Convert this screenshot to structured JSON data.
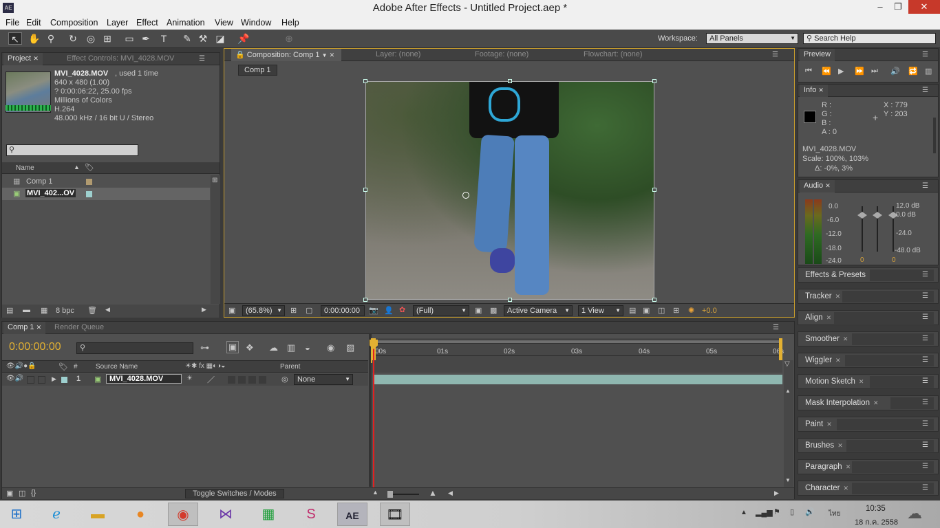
{
  "window": {
    "title": "Adobe After Effects - Untitled Project.aep *",
    "logo": "AE",
    "minimize": "–",
    "maximize": "❐",
    "close": "✕"
  },
  "menu": [
    "File",
    "Edit",
    "Composition",
    "Layer",
    "Effect",
    "Animation",
    "View",
    "Window",
    "Help"
  ],
  "toolbar": {
    "workspace_label": "Workspace:",
    "workspace_value": "All Panels",
    "search_placeholder": "Search Help"
  },
  "project": {
    "tab": "Project",
    "tab2": "Effect Controls: MVI_4028.MOV",
    "file_name": "MVI_4028.MOV",
    "used": ", used 1 time",
    "info": [
      "640 x 480 (1.00)",
      "? 0:00:06:22, 25.00 fps",
      "Millions of Colors",
      "H.264",
      "48.000 kHz / 16 bit U / Stereo"
    ],
    "col_name": "Name",
    "items": [
      {
        "name": "Comp 1",
        "color": "#b09a70"
      },
      {
        "name": "MVI_402...OV",
        "color": "#9ed0cf"
      }
    ],
    "bpc": "8 bpc"
  },
  "composition": {
    "tab": "Composition: Comp 1",
    "tab_layer": "Layer: (none)",
    "tab_footage": "Footage: (none)",
    "tab_flow": "Flowchart: (none)",
    "crumb": "Comp 1",
    "zoom": "(65.8%)",
    "timecode": "0:00:00:00",
    "resolution": "(Full)",
    "camera": "Active Camera",
    "views": "1 View",
    "exposure": "+0.0"
  },
  "preview": {
    "tab": "Preview"
  },
  "info": {
    "tab": "Info",
    "r": "R :",
    "g": "G :",
    "b": "B :",
    "a": "A : 0",
    "x": "X : 779",
    "y": "Y : 203",
    "line1": "MVI_4028.MOV",
    "line2": "Scale: 100%, 103%",
    "line3": "Δ: -0%, 3%"
  },
  "audio": {
    "tab": "Audio",
    "left_scale": [
      "0.0",
      "-6.0",
      "-12.0",
      "-18.0",
      "-24.0"
    ],
    "right_scale": [
      "12.0 dB",
      "0.0 dB",
      "-24.0",
      "-48.0 dB"
    ],
    "knob_left": "0",
    "knob_right": "0"
  },
  "side_panels": [
    "Effects & Presets",
    "Tracker",
    "Align",
    "Smoother",
    "Wiggler",
    "Motion Sketch",
    "Mask Interpolation",
    "Paint",
    "Brushes",
    "Paragraph",
    "Character"
  ],
  "timeline": {
    "tab": "Comp 1",
    "tab2": "Render Queue",
    "timecode": "0:00:00:00",
    "col_num": "#",
    "col_source": "Source Name",
    "col_parent": "Parent",
    "layer": {
      "num": "1",
      "name": "MVI_4028.MOV",
      "parent": "None"
    },
    "ruler": [
      "00s",
      "01s",
      "02s",
      "03s",
      "04s",
      "05s",
      "06s"
    ],
    "toggle": "Toggle Switches / Modes"
  },
  "taskbar": {
    "time": "10:35",
    "date": "18 ก.ค. 2558",
    "lang": "ไทย",
    "ae": "AE"
  }
}
